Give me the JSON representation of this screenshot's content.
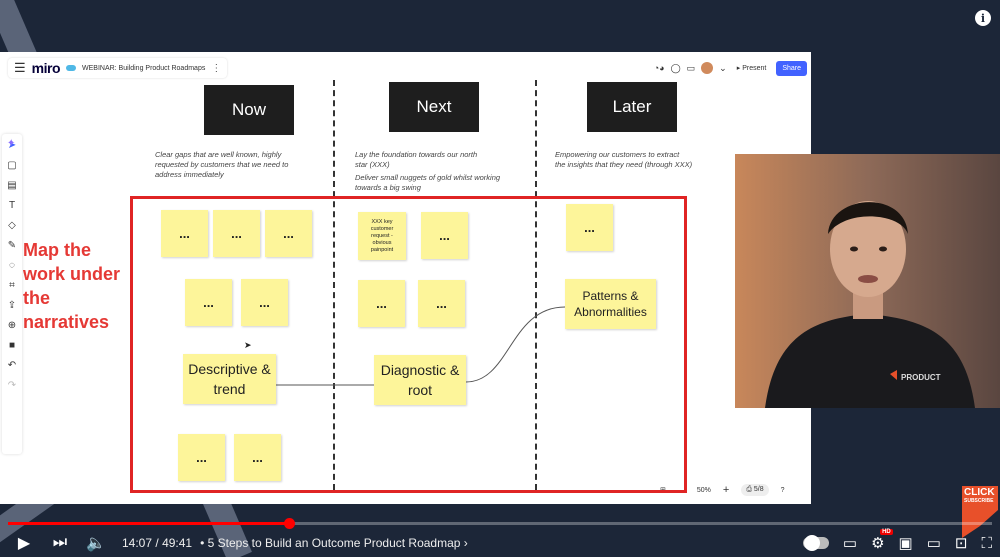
{
  "board": {
    "app_name": "miro",
    "title": "WEBINAR: Building Product Roadmaps",
    "present_label": "Present",
    "share_label": "Share",
    "zoom": "50%",
    "page": "5/8"
  },
  "columns": [
    {
      "header": "Now",
      "desc_lines": [
        "Clear gaps that are well known, highly",
        "requested by customers that we need to",
        "address immediately"
      ]
    },
    {
      "header": "Next",
      "desc_lines": [
        "Lay the foundation towards our north",
        "star (XXX)",
        "Deliver small nuggets of gold whilst working",
        "towards a big swing"
      ]
    },
    {
      "header": "Later",
      "desc_lines": [
        "Empowering our customers to extract",
        "the insights that they need (through XXX)"
      ]
    }
  ],
  "stickies": {
    "dots": "...",
    "small_note": "XXX key customer request - obvious painpoint",
    "descriptive": "Descriptive & trend",
    "diagnostic": "Diagnostic & root",
    "patterns": "Patterns & Abnormalities"
  },
  "annotation": [
    "Map the",
    "work under",
    "the",
    "narratives"
  ],
  "player": {
    "current_time": "14:07",
    "duration": "49:41",
    "time_separator": "/",
    "chapter": "5 Steps to Build an Outcome Product Roadmap",
    "progress": 0.286,
    "hd_badge": "HD"
  },
  "subscribe": {
    "line1": "CLICK",
    "line2": "SUBSCRIBE"
  },
  "webcam": {
    "shirt_logo": "PRODUCT"
  },
  "colors": {
    "background": "#1c2638",
    "sticky": "#fdf59a",
    "annotation": "#e53935",
    "progress": "#ff0000",
    "share": "#4262ff"
  }
}
